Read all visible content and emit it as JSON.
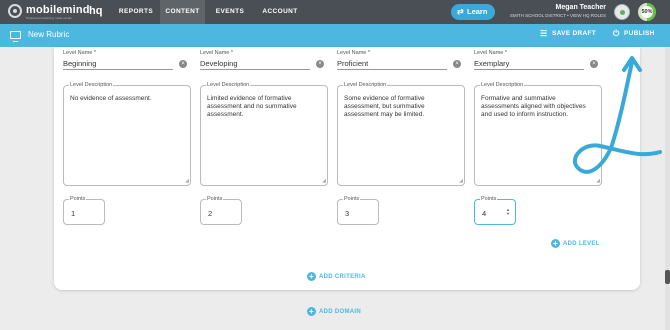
{
  "topnav": {
    "brand": "mobilemind",
    "brand_tagline": "Professional learning made simple",
    "product": "hq",
    "tabs": [
      {
        "label": "REPORTS",
        "active": false
      },
      {
        "label": "CONTENT",
        "active": true
      },
      {
        "label": "EVENTS",
        "active": false
      },
      {
        "label": "ACCOUNT",
        "active": false
      }
    ],
    "learn_label": "Learn",
    "user_name": "Megan Teacher",
    "user_sub": "SMITH SCHOOL DISTRICT • VIEW HQ ROLES",
    "progress_label": "50%",
    "progress": 0.5
  },
  "subbar": {
    "title": "New Rubric",
    "save_draft": "SAVE DRAFT",
    "publish": "PUBLISH"
  },
  "levels": [
    {
      "name_label": "Level Name *",
      "name": "Beginning",
      "desc_label": "Level Description",
      "description": "No evidence of assessment.",
      "points_label": "Points",
      "points": "1"
    },
    {
      "name_label": "Level Name *",
      "name": "Developing",
      "desc_label": "Level Description",
      "description": "Limited evidence of formative assessment and no summative assessment.",
      "points_label": "Points",
      "points": "2"
    },
    {
      "name_label": "Level Name *",
      "name": "Proficient",
      "desc_label": "Level Description",
      "description": "Some evidence of formative assessment, but summative assessment may be limited.",
      "points_label": "Points",
      "points": "3"
    },
    {
      "name_label": "Level Name *",
      "name": "Exemplary",
      "desc_label": "Level Description",
      "description": "Formative and summative assessments aligned with objectives and used to inform instruction.",
      "points_label": "Points",
      "points": "4"
    }
  ],
  "actions": {
    "add_level": "ADD LEVEL",
    "add_criteria": "ADD CRITERIA",
    "add_domain": "ADD DOMAIN"
  },
  "colors": {
    "accent": "#4cb8e0",
    "nav_bg": "#4a4f55",
    "annotation": "#3aa9d8"
  }
}
